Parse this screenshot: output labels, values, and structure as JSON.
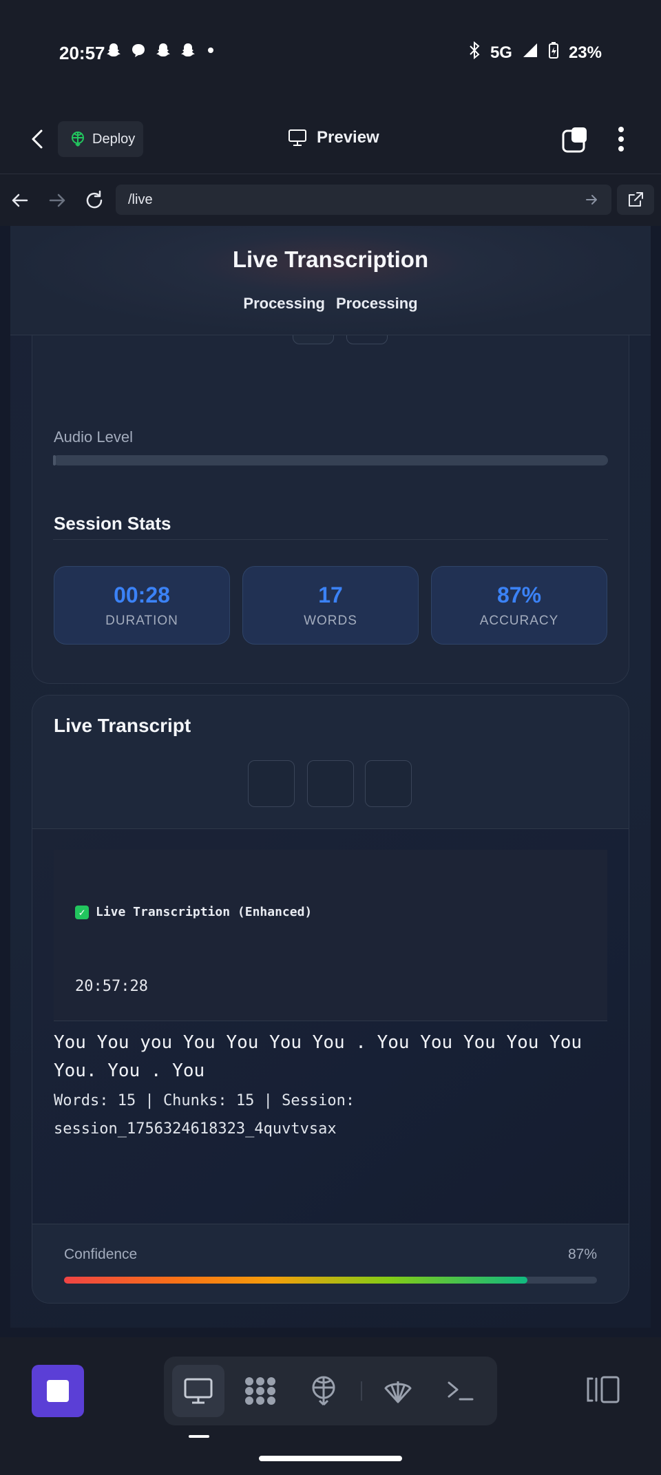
{
  "status_bar": {
    "time": "20:57",
    "network": "5G",
    "battery": "23%"
  },
  "app_header": {
    "deploy_label": "Deploy",
    "preview_label": "Preview"
  },
  "browser": {
    "url": "/live"
  },
  "hero": {
    "title": "Live Transcription",
    "badge1": "Processing",
    "badge2": "Processing"
  },
  "controls": {
    "audio_label": "Audio Level",
    "audio_level": 0.005
  },
  "session_stats": {
    "title": "Session Stats",
    "items": [
      {
        "value": "00:28",
        "label": "DURATION"
      },
      {
        "value": "17",
        "label": "WORDS"
      },
      {
        "value": "87%",
        "label": "ACCURACY"
      }
    ]
  },
  "transcript": {
    "title": "Live Transcript",
    "header": "Live Transcription (Enhanced)",
    "timestamp": "20:57:28",
    "text": "You You you You You You You . You You You You You You. You . You",
    "meta": "Words: 15 | Chunks: 15 | Session: session_1756324618323_4quvtvsax"
  },
  "confidence": {
    "label": "Confidence",
    "value_text": "87%",
    "value": 0.87
  },
  "colors": {
    "accent": "#3b82f6",
    "stop_button": "#5b3fd6",
    "card": "#1d2639"
  }
}
